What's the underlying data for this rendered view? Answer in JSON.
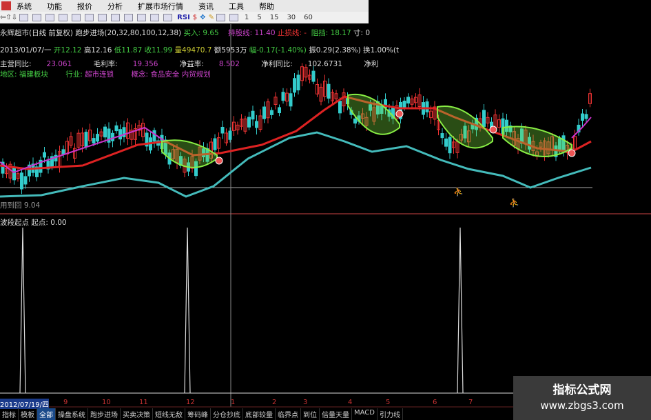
{
  "menu": [
    "系统",
    "功能",
    "报价",
    "分析",
    "扩展市场行情",
    "资讯",
    "工具",
    "帮助"
  ],
  "toolbar": {
    "rsi": "RSI",
    "periods": [
      "1",
      "5",
      "15",
      "30",
      "60"
    ]
  },
  "header": {
    "title": "永辉超市(日线 前复权) 跑步进场(20,32,80,100,12,38)",
    "buy": "买入: 9.65",
    "hold_label": "持股线: 11.40",
    "stop_label": "止损线: -",
    "pressure": "阻挡: 18.17",
    "extra": "寸: 0"
  },
  "quote": {
    "date": "2013/01/07/一",
    "open": "开12.12",
    "high": "高12.16",
    "low": "低11.87",
    "close": "收11.99",
    "vol": "量49470.7",
    "amount": "额5953万",
    "change": "幅-0.17(-1.40%)",
    "amp": "振0.29(2.38%)",
    "turnover": "换1.00%(t"
  },
  "fin": {
    "l1": "主营同比:",
    "v1": "23.061",
    "l2": "毛利率:",
    "v2": "19.356",
    "l3": "净益率:",
    "v3": "8.502",
    "l4": "净利同比:",
    "v4": "102.6731",
    "l5": "净利"
  },
  "info": {
    "l1": "地区:",
    "v1": "福建板块",
    "l2": "行业:",
    "v2": "超市连锁",
    "l3": "概念:",
    "v3": "食品安全 内贸规划"
  },
  "low_label": "用到回 9.04",
  "sub_header": "波段起点  起点: 0.00",
  "dates": [
    "2012/07/19/四",
    "9",
    "10",
    "11",
    "12",
    "1",
    "2",
    "3",
    "4",
    "5",
    "6",
    "7"
  ],
  "tabs": [
    "指标",
    "模板",
    "全部",
    "操盘系统",
    "跑步进场",
    "买卖决策",
    "短线无敌",
    "筹码峰",
    "分仓抄底",
    "底部较量",
    "临界点",
    "到位",
    "倍量天量",
    "MACD",
    "引力线"
  ],
  "watermark": {
    "title": "指标公式网",
    "url": "www.zbgs3.com"
  },
  "colors": {
    "up": "#e33",
    "down": "#3cc",
    "ma_red": "#d22",
    "ma_cyan": "#4bb",
    "band": "#8e4",
    "purple": "#c3c"
  }
}
